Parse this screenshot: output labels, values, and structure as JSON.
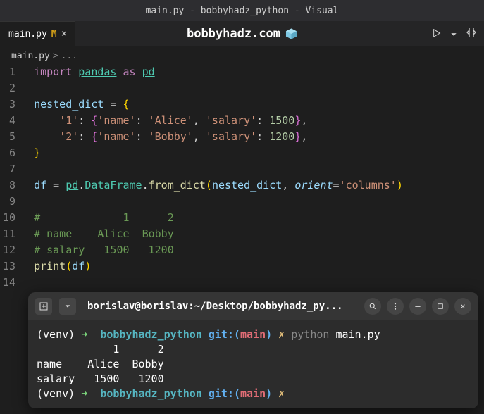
{
  "titlebar": "main.py - bobbyhadz_python - Visual",
  "tab": {
    "name": "main.py",
    "modified": "M"
  },
  "centerTitle": "bobbyhadz.com",
  "breadcrumb": {
    "file": "main.py",
    "sep": ">",
    "more": "..."
  },
  "gutter": [
    "1",
    "2",
    "3",
    "4",
    "5",
    "6",
    "7",
    "8",
    "9",
    "10",
    "11",
    "12",
    "13",
    "14"
  ],
  "code": {
    "l1": {
      "import": "import",
      "pandas": "pandas",
      "as": "as",
      "pd": "pd"
    },
    "l3": {
      "var": "nested_dict",
      "eq": " = ",
      "brace": "{"
    },
    "l4": {
      "k": "'1'",
      "colon": ": ",
      "ob": "{",
      "nk": "'name'",
      "nc": ": ",
      "nv": "'Alice'",
      "comma": ", ",
      "sk": "'salary'",
      "sc": ": ",
      "sv": "1500",
      "cb": "}",
      "tc": ","
    },
    "l5": {
      "k": "'2'",
      "colon": ": ",
      "ob": "{",
      "nk": "'name'",
      "nc": ": ",
      "nv": "'Bobby'",
      "comma": ", ",
      "sk": "'salary'",
      "sc": ": ",
      "sv": "1200",
      "cb": "}",
      "tc": ","
    },
    "l6": {
      "brace": "}"
    },
    "l8": {
      "df": "df",
      "eq": " = ",
      "pd": "pd",
      "dot1": ".",
      "cls": "DataFrame",
      "dot2": ".",
      "fn": "from_dict",
      "op": "(",
      "arg": "nested_dict",
      "comma": ", ",
      "kw": "orient",
      "eqs": "=",
      "val": "'columns'",
      "cp": ")"
    },
    "l10": "#             1      2",
    "l11": "# name    Alice  Bobby",
    "l12": "# salary   1500   1200",
    "l13": {
      "fn": "print",
      "op": "(",
      "arg": "df",
      "cp": ")"
    }
  },
  "terminal": {
    "title": "borislav@borislav:~/Desktop/bobbyhadz_py...",
    "lines": {
      "p1": {
        "venv": "(venv)",
        "arrow": " ➜  ",
        "dir": "bobbyhadz_python",
        "git": " git:(",
        "branch": "main",
        "gitc": ")",
        "dirty": " ✗ ",
        "cmd": "python ",
        "file": "main.py"
      },
      "o1": "            1      2",
      "o2": "name    Alice  Bobby",
      "o3": "salary   1500   1200",
      "p2": {
        "venv": "(venv)",
        "arrow": " ➜  ",
        "dir": "bobbyhadz_python",
        "git": " git:(",
        "branch": "main",
        "gitc": ")",
        "dirty": " ✗"
      }
    }
  }
}
